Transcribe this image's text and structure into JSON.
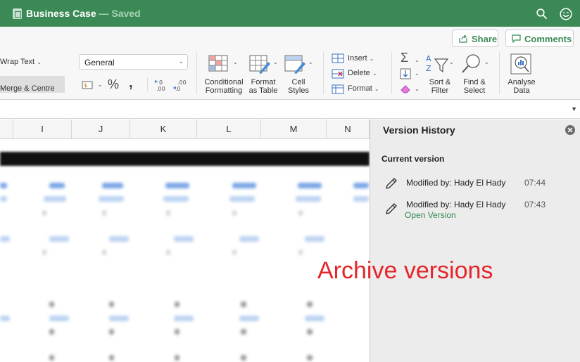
{
  "titlebar": {
    "doc_name": "Business Case",
    "status": " — Saved",
    "accent_color": "#3b8a55"
  },
  "ribbon": {
    "share_label": "Share",
    "comments_label": "Comments",
    "wrap_text_label": "Wrap Text",
    "merge_label": "Merge & Centre",
    "number_format_value": "General",
    "cond_format_label_1": "Conditional",
    "cond_format_label_2": "Formatting",
    "format_table_label_1": "Format",
    "format_table_label_2": "as Table",
    "cell_styles_label_1": "Cell",
    "cell_styles_label_2": "Styles",
    "insert_label": "Insert",
    "delete_label": "Delete",
    "format_label": "Format",
    "sort_filter_label_1": "Sort &",
    "sort_filter_label_2": "Filter",
    "find_select_label_1": "Find &",
    "find_select_label_2": "Select",
    "analyse_label_1": "Analyse",
    "analyse_label_2": "Data"
  },
  "grid": {
    "columns": [
      "I",
      "J",
      "K",
      "L",
      "M",
      "N"
    ]
  },
  "version_history": {
    "title": "Version History",
    "current_label": "Current version",
    "items": [
      {
        "modified_by": "Modified by: Hady El Hady",
        "time": "07:44"
      },
      {
        "modified_by": "Modified by: Hady El Hady",
        "time": "07:43",
        "action": "Open Version"
      }
    ]
  },
  "annotation": {
    "text": "Archive versions",
    "color": "#e5252a"
  }
}
